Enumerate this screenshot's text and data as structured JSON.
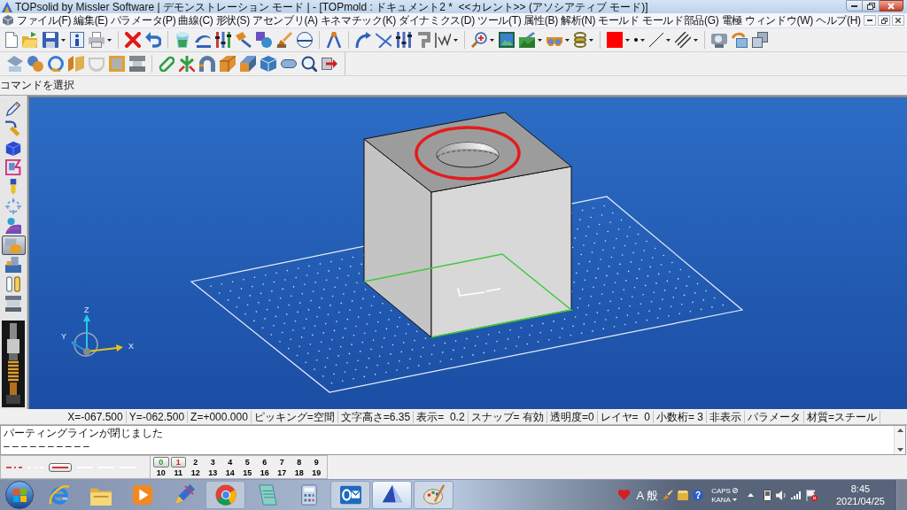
{
  "window": {
    "title": "TOPsolid by Missler Software | デモンストレーション モード | - [TOPmold : ドキュメント2 *  <<カレント>> (アソシアティブ モード)]"
  },
  "menu": [
    "ファイル(F)",
    "編集(E)",
    "パラメータ(P)",
    "曲線(C)",
    "形状(S)",
    "アセンブリ(A)",
    "キネマチック(K)",
    "ダイナミクス(D)",
    "ツール(T)",
    "属性(B)",
    "解析(N)",
    "モールド",
    "モールド部品(G)",
    "電極",
    "ウィンドウ(W)",
    "ヘルプ(H)"
  ],
  "prompt": "コマンドを選択",
  "side_toolbar": [
    {
      "selected": false
    },
    {
      "selected": false
    },
    {
      "selected": false
    },
    {
      "selected": false
    },
    {
      "selected": false
    },
    {
      "selected": false
    },
    {
      "selected": false
    },
    {
      "selected": true
    },
    {
      "selected": false
    },
    {
      "selected": false
    },
    {
      "selected": false
    }
  ],
  "viewport": {
    "axes": [
      {
        "label": "Z"
      },
      {
        "label": "Y"
      },
      {
        "label": "X"
      }
    ]
  },
  "status_fields": [
    "X=-067.500",
    "Y=-062.500",
    "Z=+000.000",
    "ピッキング=空間",
    "文字高さ=6.35",
    "表示=  0.2",
    "スナップ= 有効",
    "透明度=0",
    "レイヤ=  0",
    "小数桁= 3",
    "非表示",
    "パラメータ",
    "材質=スチール"
  ],
  "messages": [
    "パーティングラインが閉じました",
    "– – – – – – – – – –"
  ],
  "line_styles": [
    {
      "kind": "dashdot",
      "color": "#e04848",
      "selected": false
    },
    {
      "kind": "dashed",
      "color": "#ffffff",
      "selected": false
    },
    {
      "kind": "solid",
      "color": "#d83030",
      "selected": true
    },
    {
      "kind": "solid",
      "color": "#ffffff",
      "selected": false
    },
    {
      "kind": "solid",
      "color": "#ffffff",
      "selected": false
    },
    {
      "kind": "solid",
      "color": "#ffffff",
      "selected": false
    }
  ],
  "layers": [
    {
      "label": "0",
      "selected": true,
      "color": "#22a022"
    },
    {
      "label": "1",
      "selected": true,
      "color": "#d02020"
    },
    {
      "label": "2",
      "selected": false,
      "color": "#000000"
    },
    {
      "label": "3",
      "selected": false,
      "color": "#000000"
    },
    {
      "label": "4",
      "selected": false,
      "color": "#000000"
    },
    {
      "label": "5",
      "selected": false,
      "color": "#000000"
    },
    {
      "label": "6",
      "selected": false,
      "color": "#000000"
    },
    {
      "label": "7",
      "selected": false,
      "color": "#000000"
    },
    {
      "label": "8",
      "selected": false,
      "color": "#000000"
    },
    {
      "label": "9",
      "selected": false,
      "color": "#000000"
    },
    {
      "label": "10",
      "selected": false,
      "color": "#000000"
    },
    {
      "label": "11",
      "selected": false,
      "color": "#000000"
    },
    {
      "label": "12",
      "selected": false,
      "color": "#000000"
    },
    {
      "label": "13",
      "selected": false,
      "color": "#000000"
    },
    {
      "label": "14",
      "selected": false,
      "color": "#000000"
    },
    {
      "label": "15",
      "selected": false,
      "color": "#000000"
    },
    {
      "label": "16",
      "selected": false,
      "color": "#000000"
    },
    {
      "label": "17",
      "selected": false,
      "color": "#000000"
    },
    {
      "label": "18",
      "selected": false,
      "color": "#000000"
    },
    {
      "label": "19",
      "selected": false,
      "color": "#000000"
    }
  ],
  "taskbar": {
    "apps": [
      {
        "running": false,
        "selected": false
      },
      {
        "running": false,
        "selected": false
      },
      {
        "running": false,
        "selected": false
      },
      {
        "running": false,
        "selected": false
      },
      {
        "running": true,
        "selected": false
      },
      {
        "running": false,
        "selected": false
      },
      {
        "running": false,
        "selected": false
      },
      {
        "running": true,
        "selected": false
      },
      {
        "running": true,
        "selected": true
      },
      {
        "running": true,
        "selected": false
      }
    ],
    "tray": {
      "ime": [
        "A",
        "般"
      ],
      "caps": "CAPS",
      "kana": "KANA",
      "time": "8:45",
      "date": "2021/04/25"
    }
  }
}
